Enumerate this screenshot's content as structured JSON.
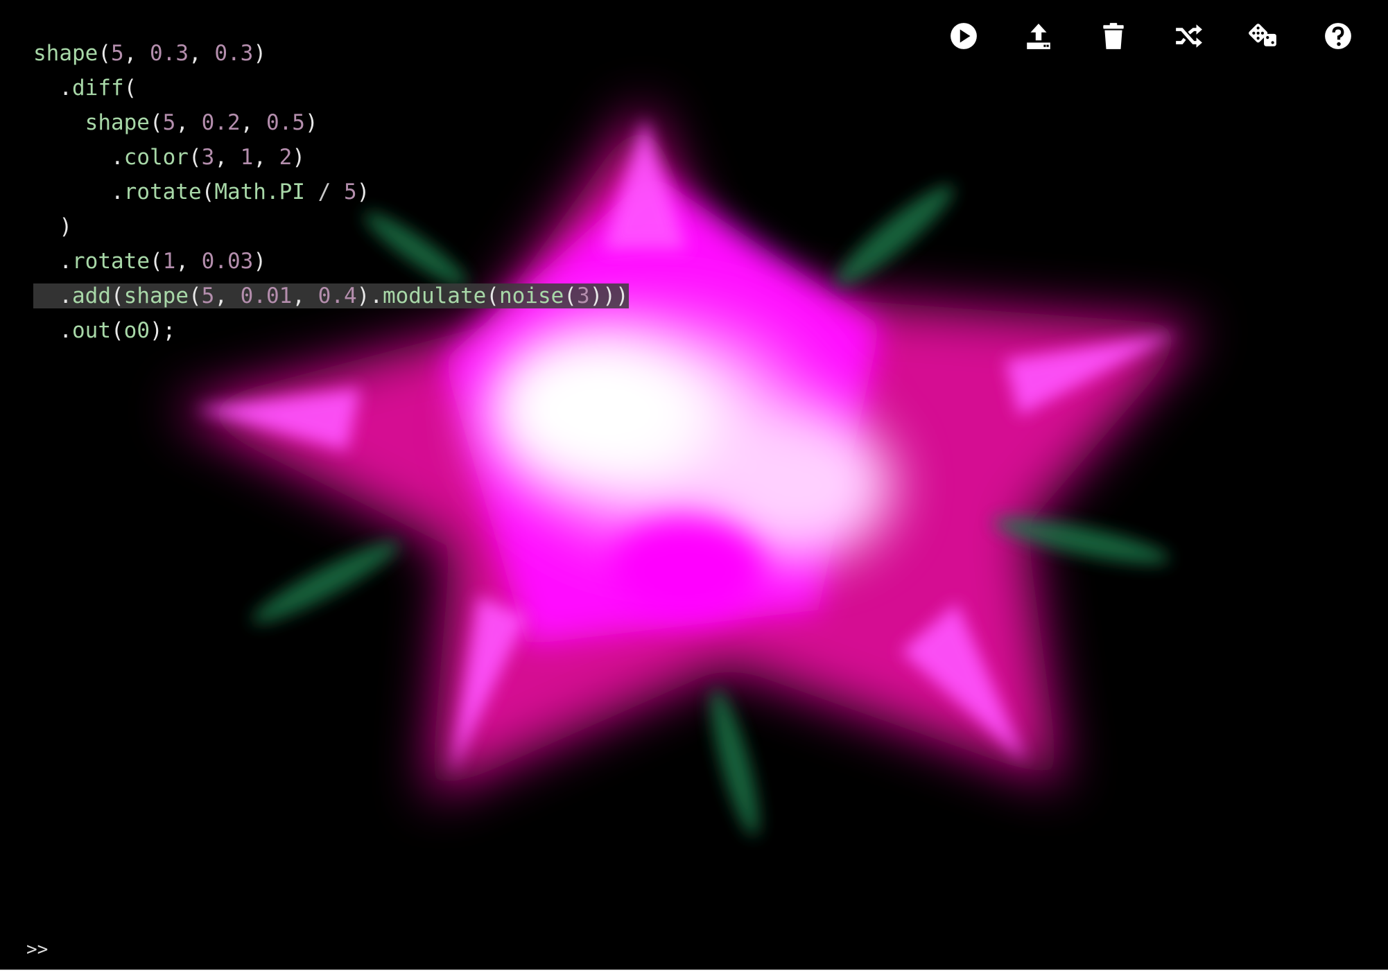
{
  "toolbar": {
    "icons": [
      "play-icon",
      "upload-icon",
      "trash-icon",
      "shuffle-icon",
      "dice-icon",
      "help-icon"
    ],
    "colors": {
      "icon": "#ffffff"
    }
  },
  "editor": {
    "lines": [
      [
        [
          "fn",
          "shape"
        ],
        [
          "punc",
          "("
        ],
        [
          "num",
          "5"
        ],
        [
          "punc",
          ", "
        ],
        [
          "num",
          "0.3"
        ],
        [
          "punc",
          ", "
        ],
        [
          "num",
          "0.3"
        ],
        [
          "punc",
          ")"
        ]
      ],
      [
        [
          "punc",
          "  ."
        ],
        [
          "fn",
          "diff"
        ],
        [
          "punc",
          "("
        ]
      ],
      [
        [
          "punc",
          "    "
        ],
        [
          "fn",
          "shape"
        ],
        [
          "punc",
          "("
        ],
        [
          "num",
          "5"
        ],
        [
          "punc",
          ", "
        ],
        [
          "num",
          "0.2"
        ],
        [
          "punc",
          ", "
        ],
        [
          "num",
          "0.5"
        ],
        [
          "punc",
          ")"
        ]
      ],
      [
        [
          "punc",
          "      ."
        ],
        [
          "fn",
          "color"
        ],
        [
          "punc",
          "("
        ],
        [
          "num",
          "3"
        ],
        [
          "punc",
          ", "
        ],
        [
          "num",
          "1"
        ],
        [
          "punc",
          ", "
        ],
        [
          "num",
          "2"
        ],
        [
          "punc",
          ")"
        ]
      ],
      [
        [
          "punc",
          "      ."
        ],
        [
          "fn",
          "rotate"
        ],
        [
          "punc",
          "("
        ],
        [
          "fn",
          "Math.PI"
        ],
        [
          "op",
          " / "
        ],
        [
          "num",
          "5"
        ],
        [
          "punc",
          ")"
        ]
      ],
      [
        [
          "punc",
          "  )"
        ]
      ],
      [
        [
          "punc",
          "  ."
        ],
        [
          "fn",
          "rotate"
        ],
        [
          "punc",
          "("
        ],
        [
          "num",
          "1"
        ],
        [
          "punc",
          ", "
        ],
        [
          "num",
          "0.03"
        ],
        [
          "punc",
          ")"
        ]
      ],
      [
        [
          "punc",
          "  ."
        ],
        [
          "fn",
          "add"
        ],
        [
          "punc",
          "("
        ],
        [
          "fn",
          "shape"
        ],
        [
          "punc",
          "("
        ],
        [
          "num",
          "5"
        ],
        [
          "punc",
          ", "
        ],
        [
          "num",
          "0.01"
        ],
        [
          "punc",
          ", "
        ],
        [
          "num",
          "0.4"
        ],
        [
          "punc",
          ")."
        ],
        [
          "fn",
          "modulate"
        ],
        [
          "punc",
          "("
        ],
        [
          "fn",
          "noise"
        ],
        [
          "punc",
          "("
        ],
        [
          "num",
          "3"
        ],
        [
          "punc",
          ")))"
        ]
      ],
      [
        [
          "punc",
          "  ."
        ],
        [
          "fn",
          "out"
        ],
        [
          "punc",
          "("
        ],
        [
          "fn",
          "o0"
        ],
        [
          "punc",
          ");"
        ]
      ]
    ],
    "selected_line": 7
  },
  "console": {
    "prompt": ">>"
  },
  "visual": {
    "colors": [
      "#ff00ff",
      "#ff1493",
      "#ffffff",
      "#1a6b4a"
    ]
  }
}
